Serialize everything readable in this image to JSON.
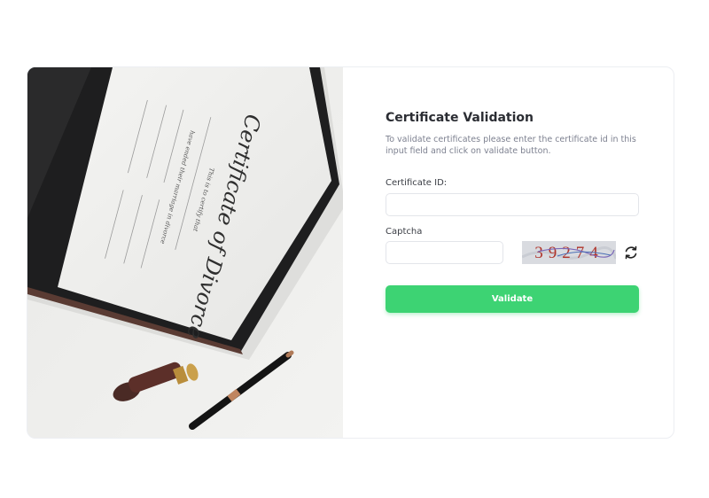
{
  "form": {
    "title": "Certificate Validation",
    "description": "To validate certificates please enter the certificate id in this input field and click on validate button.",
    "certificate_id_label": "Certificate ID:",
    "certificate_id_value": "",
    "captcha_label": "Captcha",
    "captcha_value": "",
    "captcha_code": "39274",
    "validate_label": "Validate"
  },
  "photo": {
    "certificate_heading": "Certificate of Divorce",
    "certificate_line_1": "This is to certify that",
    "certificate_line_2": "have ended their marriage in divorce"
  },
  "colors": {
    "accent": "#3dd373",
    "title": "#2b2d33",
    "muted": "#7d8190"
  },
  "icons": {
    "refresh": "refresh-icon"
  }
}
